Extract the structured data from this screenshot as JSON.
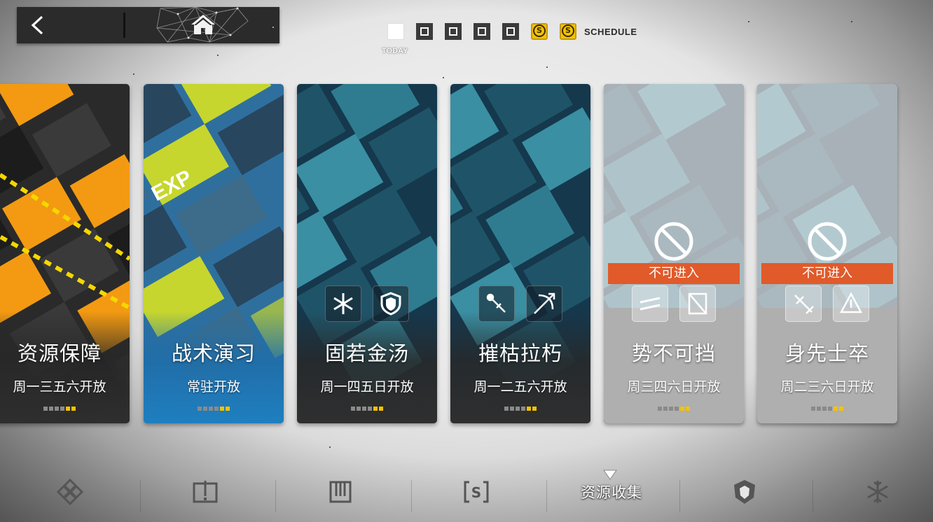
{
  "header": {
    "back_icon": "chevron-left-icon",
    "home_icon": "home-icon"
  },
  "schedule": {
    "today_label": "TODAY",
    "label": "SCHEDULE",
    "day_markers": [
      "today",
      "standard",
      "standard",
      "standard",
      "standard",
      "bonus",
      "bonus"
    ],
    "bonus_symbol": "S",
    "accent_color": "#f4c300"
  },
  "cards": [
    {
      "title": "资源保障",
      "days": "周一三五六开放",
      "locked": false,
      "progress": 2,
      "dots": 6
    },
    {
      "title": "战术演习",
      "days": "常驻开放",
      "locked": false,
      "progress": 2,
      "dots": 6
    },
    {
      "title": "固若金汤",
      "days": "周一四五日开放",
      "locked": false,
      "progress": 2,
      "dots": 6
    },
    {
      "title": "摧枯拉朽",
      "days": "周一二五六开放",
      "locked": false,
      "progress": 2,
      "dots": 6
    },
    {
      "title": "势不可挡",
      "days": "周三四六日开放",
      "locked": true,
      "lock_text": "不可进入",
      "progress": 2,
      "dots": 6
    },
    {
      "title": "身先士卒",
      "days": "周二三六日开放",
      "locked": true,
      "lock_text": "不可进入",
      "progress": 2,
      "dots": 6
    }
  ],
  "bottom_nav": {
    "items": [
      "diamond-cluster-icon",
      "mission-board-icon",
      "gate-icon",
      "bracket-s-icon",
      "资源收集",
      "shield-wolf-icon",
      "snowflake-icon"
    ],
    "active_label": "资源收集"
  },
  "colors": {
    "lock_banner": "#e05a2a",
    "gold": "#f4c300"
  }
}
